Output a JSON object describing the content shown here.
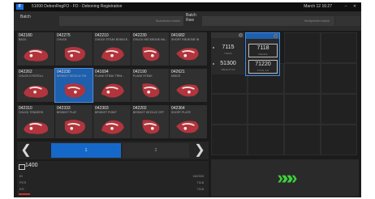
{
  "titlebar": {
    "app_title": "51000 DebonRegFO - FO - Deboning Registration",
    "datetime": "March 12 16:27",
    "minimize": "–",
    "close": "✕"
  },
  "toolbar": {
    "batch_label": "Batch",
    "batch_field_placeholder": "Scan/enter batch",
    "batch_raw_label": "Batch\nRaw",
    "batch_raw_field_placeholder": "Verify/enter batch"
  },
  "products": [
    {
      "code": "042180",
      "name": "BACK"
    },
    {
      "code": "042275",
      "name": "CHUCK"
    },
    {
      "code": "042210",
      "name": "CHUCK STEAK BONELE..."
    },
    {
      "code": "042230",
      "name": "CHUCK NECKBONE MIL..."
    },
    {
      "code": "041682",
      "name": "SHORT RIB BONE IN"
    },
    {
      "code": "042262",
      "name": "CHUCK EYE/ROLL"
    },
    {
      "code": "042230",
      "name": "BRISKET DECKLE ON"
    },
    {
      "code": "041694",
      "name": "FLANK STEAK TRIM..."
    },
    {
      "code": "042190",
      "name": "FLANK STEAK"
    },
    {
      "code": "042621",
      "name": "MINCE"
    },
    {
      "code": "042310",
      "name": "CHUCK TENDERS"
    },
    {
      "code": "042333",
      "name": "BRISKET FLAT"
    },
    {
      "code": "042303",
      "name": "BRISKET POINT"
    },
    {
      "code": "042202",
      "name": "BRISKET DECKLE OFF"
    },
    {
      "code": "042364",
      "name": "SHORT PLATE"
    }
  ],
  "selected_product_index": 6,
  "pagination": {
    "prev": "❮",
    "next": "❯",
    "page1": "1",
    "page2": "2",
    "active_page": "1"
  },
  "cart": {
    "items": [
      {
        "close": "✕"
      },
      {
        "close": "✕",
        "selected": true
      }
    ],
    "stats": [
      {
        "value": "7115",
        "unit": "ITEMS"
      },
      {
        "value": "7118",
        "unit": "PIECES"
      },
      {
        "value": "51300",
        "unit": "WEIGHT KG"
      },
      {
        "value": "71220",
        "unit": "TOTAL KG"
      }
    ]
  },
  "summary": {
    "title": "1400",
    "rows": [
      {
        "key": "ID",
        "value": "042333"
      },
      {
        "key": "PCS",
        "value": "7118"
      },
      {
        "key": "KG",
        "value": "7118"
      }
    ]
  },
  "confirm": {
    "label": "»»»"
  },
  "colors": {
    "accent": "#1e5fae",
    "confirm": "#3fd13a",
    "background": "#1b1b1b"
  }
}
